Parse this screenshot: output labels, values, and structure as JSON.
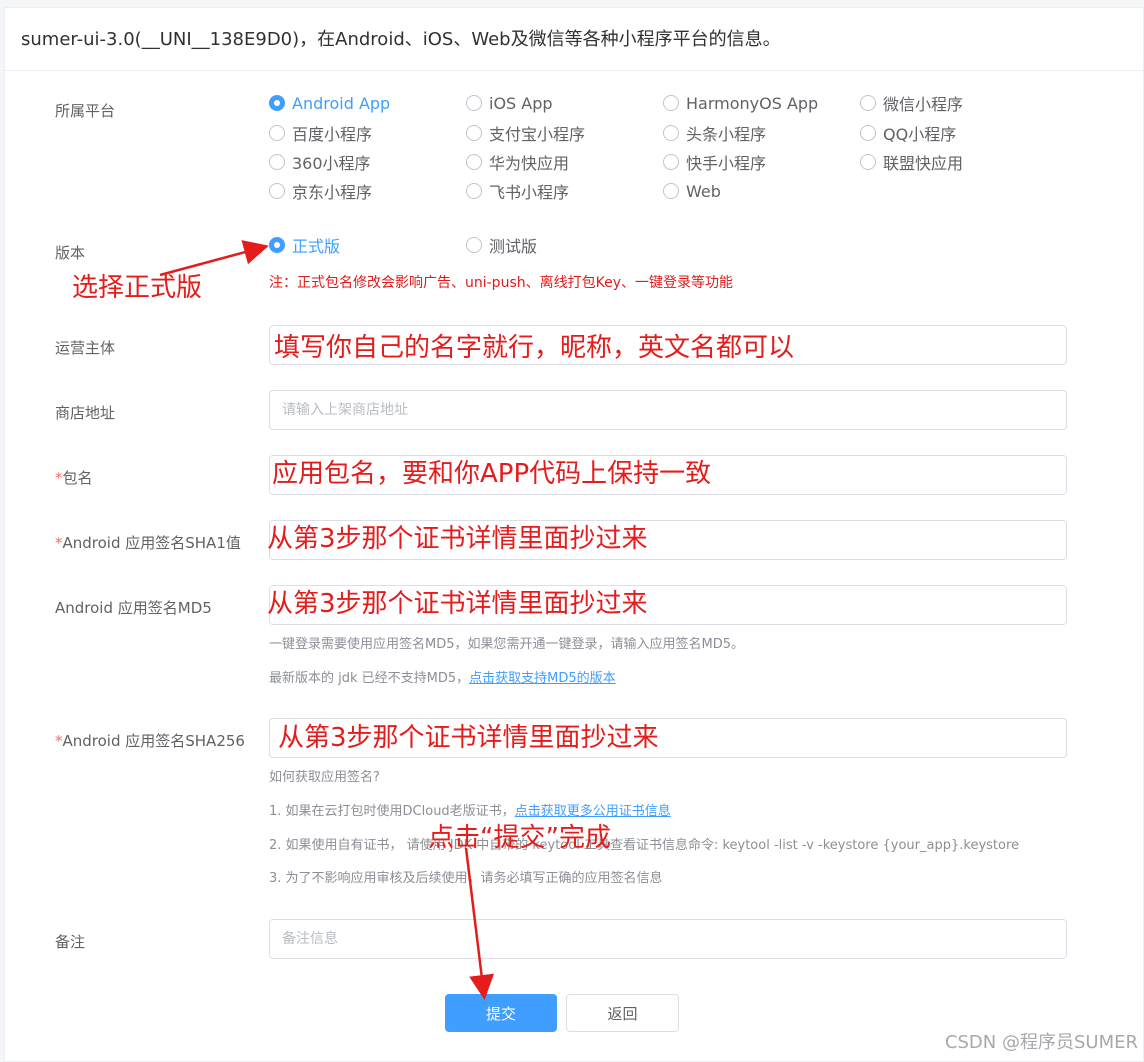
{
  "header": {
    "title": "sumer-ui-3.0(__UNI__138E9D0)，在Android、iOS、Web及微信等各种小程序平台的信息。"
  },
  "platform": {
    "label": "所属平台",
    "options": [
      "Android App",
      "iOS App",
      "HarmonyOS App",
      "微信小程序",
      "百度小程序",
      "支付宝小程序",
      "头条小程序",
      "QQ小程序",
      "360小程序",
      "华为快应用",
      "快手小程序",
      "联盟快应用",
      "京东小程序",
      "飞书小程序",
      "Web"
    ],
    "selected": "Android App"
  },
  "version": {
    "label": "版本",
    "options": [
      "正式版",
      "测试版"
    ],
    "selected": "正式版",
    "warning": "注：正式包名修改会影响广告、uni-push、离线打包Key、一键登录等功能"
  },
  "operator": {
    "label": "运营主体",
    "placeholder": "",
    "value": ""
  },
  "store": {
    "label": "商店地址",
    "placeholder": "请输入上架商店地址",
    "value": ""
  },
  "package": {
    "required_mark": "*",
    "label": "包名",
    "placeholder": "",
    "value": ""
  },
  "sha1": {
    "required_mark": "*",
    "label": "Android 应用签名SHA1值",
    "placeholder": "",
    "value": ""
  },
  "md5": {
    "label": "Android 应用签名MD5",
    "placeholder": "",
    "value": "",
    "note1": "一键登录需要使用应用签名MD5，如果您需开通一键登录，请输入应用签名MD5。",
    "note2_prefix": "最新版本的 jdk 已经不支持MD5，",
    "note2_link": "点击获取支持MD5的版本"
  },
  "sha256": {
    "required_mark": "*",
    "label": "Android 应用签名SHA256",
    "placeholder": "",
    "value": "",
    "help_title": "如何获取应用签名?",
    "help1_prefix": "1. 如果在云打包时使用DCloud老版证书，",
    "help1_link": "点击获取更多公用证书信息",
    "help2": "2. 如果使用自有证书， 请使用 JDK 中自带的 keytool 工具查看证书信息命令: keytool -list -v -keystore {your_app}.keystore",
    "help3": "3. 为了不影响应用审核及后续使用，请务必填写正确的应用签名信息"
  },
  "remark": {
    "label": "备注",
    "placeholder": "备注信息",
    "value": ""
  },
  "buttons": {
    "submit": "提交",
    "back": "返回"
  },
  "annotations": {
    "choose_release": "选择正式版",
    "fill_name": "填写你自己的名字就行，昵称，英文名都可以",
    "package_hint": "应用包名，要和你APP代码上保持一致",
    "copy_sha1": "从第3步那个证书详情里面抄过来",
    "copy_md5": "从第3步那个证书详情里面抄过来",
    "copy_sha256": "从第3步那个证书详情里面抄过来",
    "click_submit": "点击“提交”完成"
  },
  "watermark": "CSDN @程序员SUMER",
  "colors": {
    "primary": "#409eff",
    "annotation": "#e41c1c",
    "required": "#f56c6c"
  }
}
